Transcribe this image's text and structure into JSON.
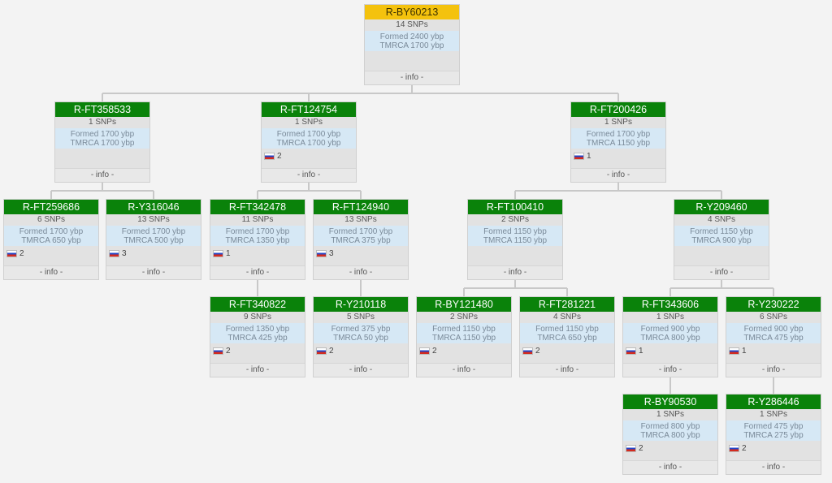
{
  "info_label": "- info -",
  "colors": {
    "node_header": "#0a820a",
    "root_header": "#f4c20d",
    "dates_bg": "#d6e8f5",
    "line": "#c8c8c8"
  },
  "nodes": {
    "root": {
      "name": "R-BY60213",
      "snps": "14 SNPs",
      "formed": "Formed 2400 ybp",
      "tmrca": "TMRCA 1700 ybp",
      "country_count": "",
      "country_icon": ""
    },
    "ft358533": {
      "name": "R-FT358533",
      "snps": "1 SNPs",
      "formed": "Formed 1700 ybp",
      "tmrca": "TMRCA 1700 ybp",
      "country_count": "",
      "country_icon": ""
    },
    "ft124754": {
      "name": "R-FT124754",
      "snps": "1 SNPs",
      "formed": "Formed 1700 ybp",
      "tmrca": "TMRCA 1700 ybp",
      "country_count": "2",
      "country_icon": "russia-flag-icon"
    },
    "ft200426": {
      "name": "R-FT200426",
      "snps": "1 SNPs",
      "formed": "Formed 1700 ybp",
      "tmrca": "TMRCA 1150 ybp",
      "country_count": "1",
      "country_icon": "russia-flag-icon"
    },
    "ft259686": {
      "name": "R-FT259686",
      "snps": "6 SNPs",
      "formed": "Formed 1700 ybp",
      "tmrca": "TMRCA 650 ybp",
      "country_count": "2",
      "country_icon": "russia-flag-icon"
    },
    "y316046": {
      "name": "R-Y316046",
      "snps": "13 SNPs",
      "formed": "Formed 1700 ybp",
      "tmrca": "TMRCA 500 ybp",
      "country_count": "3",
      "country_icon": "russia-flag-icon"
    },
    "ft342478": {
      "name": "R-FT342478",
      "snps": "11 SNPs",
      "formed": "Formed 1700 ybp",
      "tmrca": "TMRCA 1350 ybp",
      "country_count": "1",
      "country_icon": "russia-flag-icon"
    },
    "ft124940": {
      "name": "R-FT124940",
      "snps": "13 SNPs",
      "formed": "Formed 1700 ybp",
      "tmrca": "TMRCA 375 ybp",
      "country_count": "3",
      "country_icon": "russia-flag-icon"
    },
    "ft100410": {
      "name": "R-FT100410",
      "snps": "2 SNPs",
      "formed": "Formed 1150 ybp",
      "tmrca": "TMRCA 1150 ybp",
      "country_count": "",
      "country_icon": ""
    },
    "y209460": {
      "name": "R-Y209460",
      "snps": "4 SNPs",
      "formed": "Formed 1150 ybp",
      "tmrca": "TMRCA 900 ybp",
      "country_count": "",
      "country_icon": ""
    },
    "ft340822": {
      "name": "R-FT340822",
      "snps": "9 SNPs",
      "formed": "Formed 1350 ybp",
      "tmrca": "TMRCA 425 ybp",
      "country_count": "2",
      "country_icon": "russia-flag-icon"
    },
    "y210118": {
      "name": "R-Y210118",
      "snps": "5 SNPs",
      "formed": "Formed 375 ybp",
      "tmrca": "TMRCA 50 ybp",
      "country_count": "2",
      "country_icon": "russia-flag-icon"
    },
    "by121480": {
      "name": "R-BY121480",
      "snps": "2 SNPs",
      "formed": "Formed 1150 ybp",
      "tmrca": "TMRCA 1150 ybp",
      "country_count": "2",
      "country_icon": "russia-flag-icon"
    },
    "ft281221": {
      "name": "R-FT281221",
      "snps": "4 SNPs",
      "formed": "Formed 1150 ybp",
      "tmrca": "TMRCA 650 ybp",
      "country_count": "2",
      "country_icon": "russia-flag-icon"
    },
    "ft343606": {
      "name": "R-FT343606",
      "snps": "1 SNPs",
      "formed": "Formed 900 ybp",
      "tmrca": "TMRCA 800 ybp",
      "country_count": "1",
      "country_icon": "russia-flag-icon"
    },
    "y230222": {
      "name": "R-Y230222",
      "snps": "6 SNPs",
      "formed": "Formed 900 ybp",
      "tmrca": "TMRCA 475 ybp",
      "country_count": "1",
      "country_icon": "russia-flag-icon"
    },
    "by90530": {
      "name": "R-BY90530",
      "snps": "1 SNPs",
      "formed": "Formed 800 ybp",
      "tmrca": "TMRCA 800 ybp",
      "country_count": "2",
      "country_icon": "russia-flag-icon"
    },
    "y286446": {
      "name": "R-Y286446",
      "snps": "1 SNPs",
      "formed": "Formed 475 ybp",
      "tmrca": "TMRCA 275 ybp",
      "country_count": "2",
      "country_icon": "russia-flag-icon"
    }
  },
  "edges": [
    [
      "root",
      "ft358533"
    ],
    [
      "root",
      "ft124754"
    ],
    [
      "root",
      "ft200426"
    ],
    [
      "ft358533",
      "ft259686"
    ],
    [
      "ft358533",
      "y316046"
    ],
    [
      "ft124754",
      "ft342478"
    ],
    [
      "ft124754",
      "ft124940"
    ],
    [
      "ft200426",
      "ft100410"
    ],
    [
      "ft200426",
      "y209460"
    ],
    [
      "ft342478",
      "ft340822"
    ],
    [
      "ft124940",
      "y210118"
    ],
    [
      "ft100410",
      "by121480"
    ],
    [
      "ft100410",
      "ft281221"
    ],
    [
      "y209460",
      "ft343606"
    ],
    [
      "y209460",
      "y230222"
    ],
    [
      "ft343606",
      "by90530"
    ],
    [
      "y230222",
      "y286446"
    ]
  ]
}
